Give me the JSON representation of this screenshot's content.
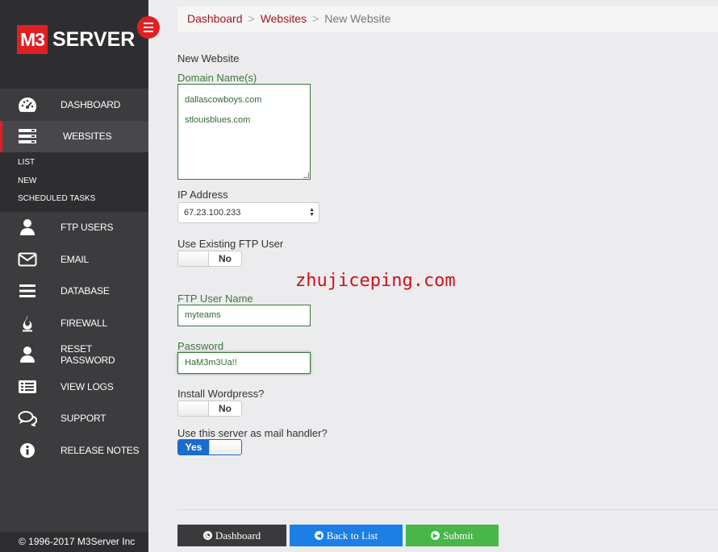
{
  "brand": {
    "logo_box": "M3",
    "logo_text": "SERVER"
  },
  "nav": {
    "items": [
      {
        "label": "DASHBOARD",
        "icon": "gauge-icon"
      },
      {
        "label": "WEBSITES",
        "icon": "server-icon"
      },
      {
        "label": "FTP USERS",
        "icon": "user-icon"
      },
      {
        "label": "EMAIL",
        "icon": "envelope-icon"
      },
      {
        "label": "DATABASE",
        "icon": "bars-icon"
      },
      {
        "label": "FIREWALL",
        "icon": "fire-icon"
      },
      {
        "label": "RESET PASSWORD",
        "icon": "user-icon"
      },
      {
        "label": "VIEW LOGS",
        "icon": "list-icon"
      },
      {
        "label": "SUPPORT",
        "icon": "comments-icon"
      },
      {
        "label": "RELEASE NOTES",
        "icon": "info-icon"
      }
    ],
    "sub_items": [
      "LIST",
      "NEW",
      "SCHEDULED TASKS"
    ]
  },
  "footer": {
    "text": "© 1996-2017 M3Server Inc"
  },
  "breadcrumb": {
    "first": "Dashboard",
    "second": "Websites",
    "current": "New Website",
    "sep": ">"
  },
  "form": {
    "heading": "New Website",
    "domain_label": "Domain Name(s)",
    "domains": [
      "dallascowboys.com",
      "stlouisblues.com"
    ],
    "ip_label": "IP Address",
    "ip_value": "67.23.100.233",
    "existing_ftp_label": "Use Existing FTP User",
    "existing_ftp_value": "No",
    "ftp_user_label": "FTP User Name",
    "ftp_user_value": "myteams",
    "password_label": "Password",
    "password_value": "HaM3m3Ua!!",
    "wordpress_label": "Install Wordpress?",
    "wordpress_value": "No",
    "mail_label": "Use this server as mail handler?",
    "mail_value": "Yes"
  },
  "watermark": "zhujiceping.com",
  "buttons": {
    "dashboard": "Dashboard",
    "back": "Back to List",
    "submit": "Submit"
  },
  "colors": {
    "accent_red": "#e01f24",
    "sidebar": "#3c3c3f",
    "link_red": "#a8151a",
    "form_green": "#3c763d",
    "btn_blue": "#1b7fe6",
    "btn_green": "#46b748"
  }
}
